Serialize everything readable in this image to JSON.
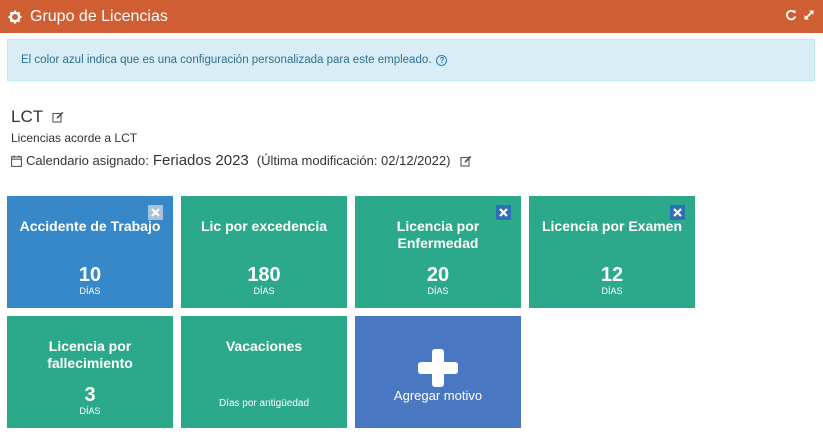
{
  "header": {
    "title": "Grupo de Licencias"
  },
  "info": {
    "text": "El color azul indica que es una configuración personalizada para este empleado.",
    "help_glyph": "?"
  },
  "group": {
    "name": "LCT",
    "description": "Licencias acorde a LCT",
    "calendar_label": "Calendario asignado:",
    "calendar_name": "Feriados 2023",
    "modified": "(Última modificación: 02/12/2022)"
  },
  "tiles": [
    {
      "title": "Accidente de Trabajo",
      "value": "10",
      "unit": "DÍAS",
      "custom": true,
      "removable": true
    },
    {
      "title": "Lic por excedencia",
      "value": "180",
      "unit": "DÍAS",
      "custom": false,
      "removable": false
    },
    {
      "title": "Licencia por Enfermedad",
      "value": "20",
      "unit": "DÍAS",
      "custom": false,
      "removable": true
    },
    {
      "title": "Licencia por Examen",
      "value": "12",
      "unit": "DÍAS",
      "custom": false,
      "removable": true
    },
    {
      "title": "Licencia por fallecimiento",
      "value": "3",
      "unit": "DÍAS",
      "custom": false,
      "removable": false
    },
    {
      "title": "Vacaciones",
      "subtitle": "Días por antigüedad",
      "custom": false,
      "removable": false
    }
  ],
  "add_tile": {
    "label": "Agregar motivo"
  },
  "colors": {
    "header": "#cf5f33",
    "tile_green": "#2ca98a",
    "tile_blue": "#3688c9",
    "tile_add": "#4a77c1",
    "info_bg": "#d9edf7"
  },
  "icons": {
    "header": "gear-icon",
    "refresh": "refresh-icon",
    "expand": "expand-icon",
    "edit": "edit-icon",
    "calendar": "calendar-icon",
    "remove": "close-icon",
    "add": "plus-icon"
  }
}
